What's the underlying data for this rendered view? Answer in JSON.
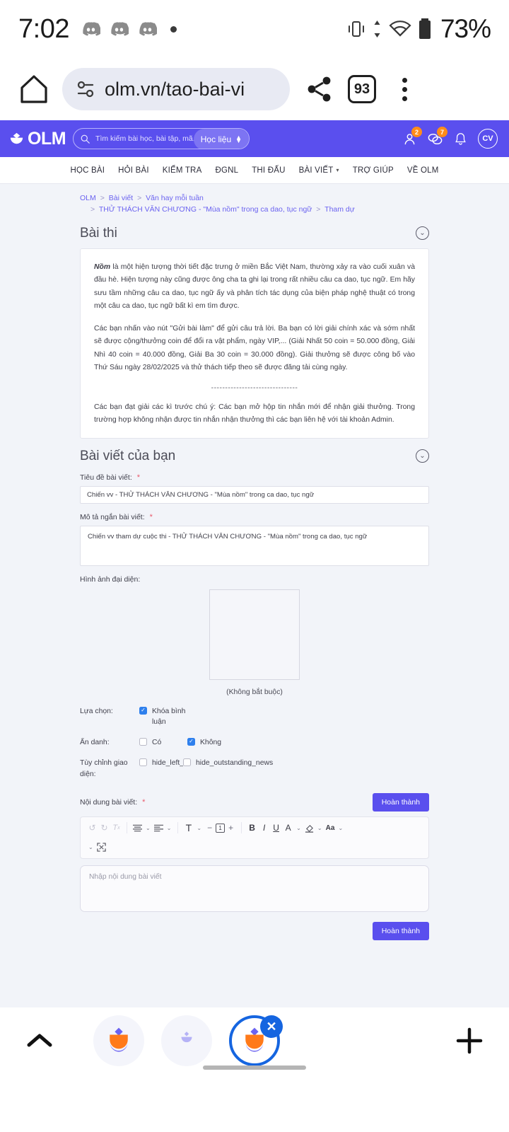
{
  "status_bar": {
    "time": "7:02",
    "battery_percent": "73%",
    "icons": [
      "discord-icon",
      "discord-icon",
      "discord-icon",
      "dot-icon",
      "vibrate-icon",
      "data-transfer-icon",
      "wifi-icon",
      "battery-icon"
    ]
  },
  "browser": {
    "url": "olm.vn/tao-bai-vi",
    "tab_count": "93",
    "icons": [
      "home-icon",
      "page-info-icon",
      "share-icon",
      "tab-switcher-icon",
      "overflow-menu-icon"
    ]
  },
  "site_header": {
    "logo_text": "OLM",
    "search_placeholder": "Tìm kiếm bài học, bài tập, mã...",
    "scope_selector": "Học liệu",
    "friends_badge": "2",
    "messages_badge": "7",
    "avatar_initials": "CV"
  },
  "nav": {
    "items": [
      {
        "label": "HỌC BÀI",
        "has_caret": false
      },
      {
        "label": "HỎI BÀI",
        "has_caret": false
      },
      {
        "label": "KIỂM TRA",
        "has_caret": false
      },
      {
        "label": "ĐGNL",
        "has_caret": false
      },
      {
        "label": "THI ĐẤU",
        "has_caret": false
      },
      {
        "label": "BÀI VIẾT",
        "has_caret": true
      },
      {
        "label": "TRỢ GIÚP",
        "has_caret": false
      },
      {
        "label": "VỀ OLM",
        "has_caret": false
      }
    ]
  },
  "breadcrumb": {
    "line1": [
      "OLM",
      "Bài viết",
      "Văn hay mỗi tuần"
    ],
    "line2": [
      "THỬ THÁCH VĂN CHƯƠNG - \"Mùa nồm\" trong ca dao, tục ngữ",
      "Tham dự"
    ]
  },
  "exam": {
    "title": "Bài thi",
    "para1_bold": "Nồm",
    "para1": " là một hiện tượng thời tiết đặc trưng ở miền Bắc Việt Nam, thường xảy ra vào cuối xuân và đầu hè. Hiện tượng này cũng được ông cha ta ghi lại trong rất nhiều câu ca dao, tục ngữ. Em hãy sưu tầm những câu ca dao, tục ngữ ấy và phân tích tác dụng của biện pháp nghệ thuật có trong một câu ca dao, tục ngữ bất kì em tìm được.",
    "para2": "Các bạn nhấn vào nút \"Gửi bài làm\" để gửi câu trả lời. Ba bạn có lời giải chính xác và sớm nhất sẽ được cộng/thưởng coin để đổi ra vật phẩm, ngày VIP,... (Giải Nhất 50 coin = 50.000 đồng, Giải Nhì 40 coin = 40.000 đồng, Giải Ba 30 coin = 30.000 đồng). Giải thưởng sẽ được công bố vào Thứ Sáu ngày 28/02/2025 và thử thách tiếp theo sẽ được đăng tải cùng ngày.",
    "divider": "-------------------------------",
    "para3": "Các bạn đạt giải các kì trước chú ý: Các bạn mở hộp tin nhắn mới để nhận giải thưởng. Trong trường hợp không nhận được tin nhắn nhận thưởng thì các bạn liên hệ với tài khoản Admin."
  },
  "form": {
    "title": "Bài viết của bạn",
    "title_label": "Tiêu đề bài viết:",
    "title_value": "Chiến vv - THỬ THÁCH VĂN CHƯƠNG - \"Mùa nồm\" trong ca dao, tục ngữ",
    "desc_label": "Mô tả ngắn bài viết:",
    "desc_value": "Chiến vv tham dự cuộc thi - THỬ THÁCH VĂN CHƯƠNG - \"Mùa nồm\" trong ca dao, tục ngữ",
    "image_label": "Hình ảnh đại diện:",
    "image_note": "(Không bắt buộc)",
    "options_label": "Lựa chọn:",
    "option_lock_comment": "Khóa bình luận",
    "anon_label": "Ẩn danh:",
    "anon_yes": "Có",
    "anon_no": "Không",
    "ui_label": "Tùy chỉnh giao diện:",
    "ui_hide_left": "hide_left_b",
    "ui_hide_outstanding": "hide_outstanding_news",
    "content_label": "Nội dung bài viết:",
    "required_mark": "*",
    "submit_top": "Hoàn thành",
    "submit_bottom": "Hoàn thành",
    "editor_placeholder": "Nhập nội dung bài viết",
    "checked": {
      "lock_comment": true,
      "anon_yes": false,
      "anon_no": true,
      "hide_left": false,
      "hide_outstanding": false
    }
  },
  "toolbar": {
    "buttons": [
      {
        "name": "undo-icon",
        "glyph": "↺",
        "dim": true
      },
      {
        "name": "redo-icon",
        "glyph": "↻",
        "dim": true
      },
      {
        "name": "clear-format-icon",
        "glyph": "Tₓ",
        "dim": true
      },
      {
        "name": "align-center-icon",
        "glyph": "≡"
      },
      {
        "name": "chevron-down-icon",
        "glyph": "⌄"
      },
      {
        "name": "align-left-icon",
        "glyph": "≡"
      },
      {
        "name": "chevron-down-icon",
        "glyph": "⌄"
      },
      {
        "name": "font-size-icon",
        "glyph": "T"
      },
      {
        "name": "chevron-down-icon",
        "glyph": "⌄"
      },
      {
        "name": "decrease-indent-icon",
        "glyph": "−"
      },
      {
        "name": "line-number-box",
        "glyph": "1"
      },
      {
        "name": "increase-indent-icon",
        "glyph": "+"
      },
      {
        "name": "bold-icon",
        "glyph": "B"
      },
      {
        "name": "italic-icon",
        "glyph": "I"
      },
      {
        "name": "underline-icon",
        "glyph": "U"
      },
      {
        "name": "text-color-icon",
        "glyph": "A"
      },
      {
        "name": "chevron-down-icon",
        "glyph": "⌄"
      },
      {
        "name": "highlight-color-icon",
        "glyph": "⬟"
      },
      {
        "name": "chevron-down-icon",
        "glyph": "⌄"
      },
      {
        "name": "font-family-icon",
        "glyph": "Aa"
      },
      {
        "name": "chevron-down-icon",
        "glyph": "⌄"
      },
      {
        "name": "more-options-icon",
        "glyph": "⌄"
      },
      {
        "name": "fullscreen-icon",
        "glyph": "⤢"
      }
    ]
  },
  "android_nav": {
    "icons": [
      "chevron-up-icon",
      "olm-app-icon",
      "olm-app-muted-icon",
      "olm-app-active-icon",
      "close-icon",
      "add-tab-icon"
    ]
  }
}
